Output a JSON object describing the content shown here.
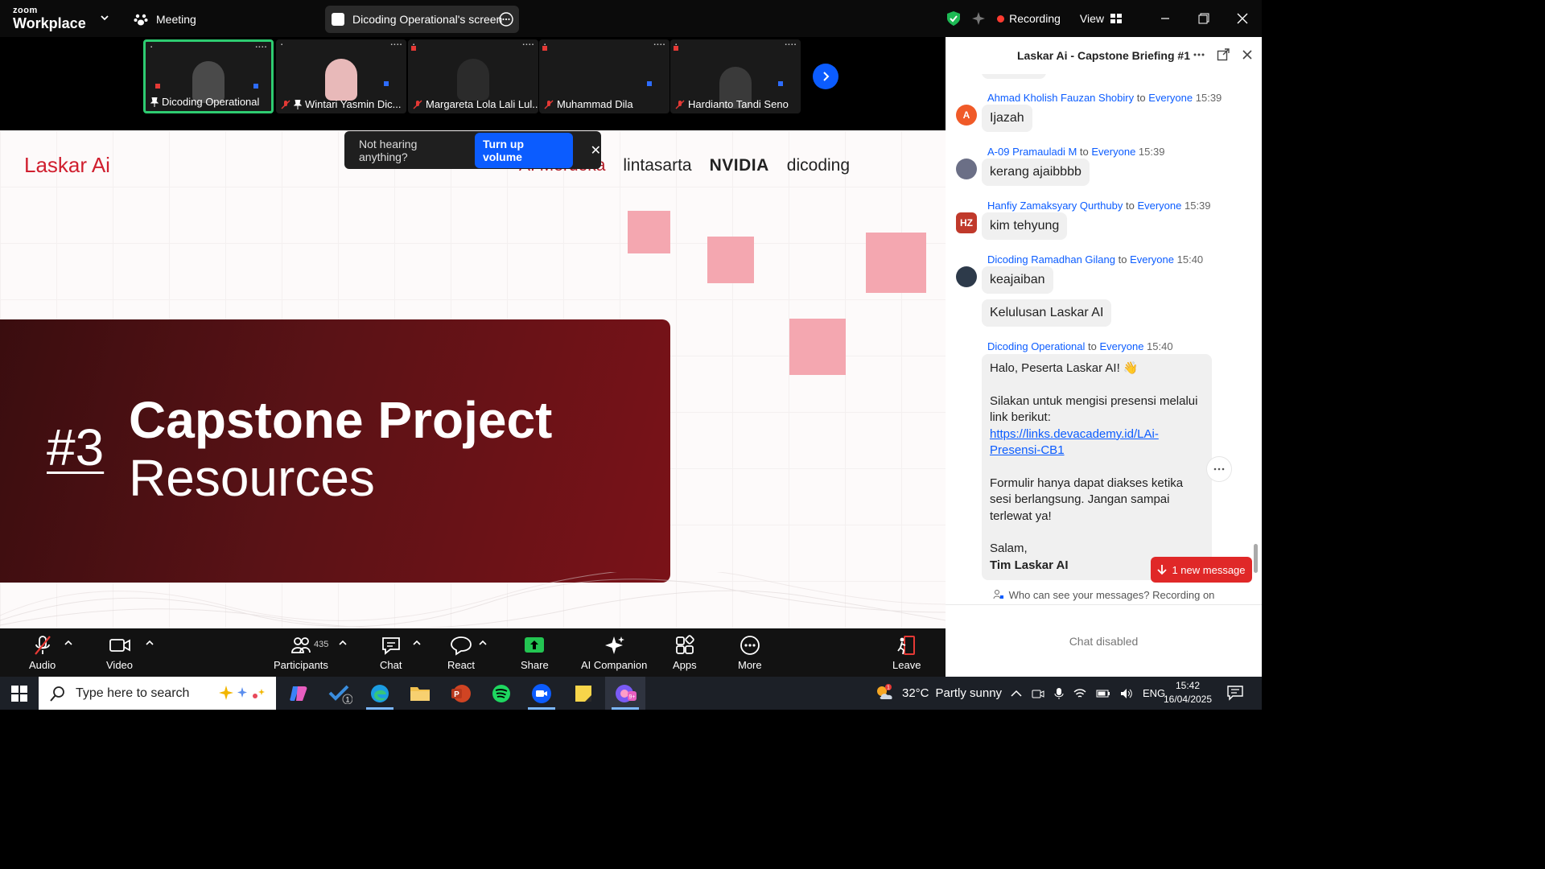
{
  "topbar": {
    "brand_small": "zoom",
    "brand_large": "Workplace",
    "meeting_label": "Meeting",
    "screen_label": "Dicoding Operational's screen",
    "recording_label": "Recording",
    "view_label": "View"
  },
  "strip": {
    "tiles": [
      {
        "name": "Dicoding Operational"
      },
      {
        "name": "Wintari Yasmin Dic..."
      },
      {
        "name": "Margareta Lola Lali Lul..."
      },
      {
        "name": "Muhammad Dila"
      },
      {
        "name": "Hardianto Tandi Seno"
      }
    ]
  },
  "slide": {
    "brand": "Laskar Ai",
    "partners": [
      "AI Merdeka",
      "lintasarta",
      "NVIDIA",
      "dicoding"
    ],
    "number": "#3",
    "title_bold": "Capstone Project",
    "title_light": "Resources"
  },
  "toast": {
    "text": "Not hearing anything?",
    "button": "Turn up volume"
  },
  "toolbar": {
    "audio": "Audio",
    "video": "Video",
    "participants": "Participants",
    "participants_count": "435",
    "chat": "Chat",
    "react": "React",
    "share": "Share",
    "ai_companion": "AI Companion",
    "apps": "Apps",
    "more": "More",
    "leave": "Leave"
  },
  "chat": {
    "title": "Laskar Ai - Capstone Briefing #1",
    "to_word": "to",
    "messages": [
      {
        "sender": "Ahmad Kholish Fauzan Shobiry",
        "recipient": "Everyone",
        "time": "15:39",
        "avatar": "A",
        "text": "Ijazah"
      },
      {
        "sender": "A-09 Pramauladi M",
        "recipient": "Everyone",
        "time": "15:39",
        "avatar": "",
        "text": "kerang ajaibbbb"
      },
      {
        "sender": "Hanfiy Zamaksyary Qurthuby",
        "recipient": "Everyone",
        "time": "15:39",
        "avatar": "HZ",
        "text": "kim tehyung"
      },
      {
        "sender": "Dicoding Ramadhan Gilang",
        "recipient": "Everyone",
        "time": "15:40",
        "avatar": "",
        "text": "keajaiban",
        "text2": "Kelulusan Laskar AI"
      },
      {
        "sender": "Dicoding Operational",
        "recipient": "Everyone",
        "time": "15:40"
      }
    ],
    "long_message": {
      "greeting": "Halo, Peserta Laskar AI! 👋",
      "line1": "Silakan untuk mengisi presensi melalui link berikut:",
      "link": "https://links.devacademy.id/LAi-Presensi-CB1",
      "line2": "Formulir hanya dapat diakses ketika sesi berlangsung. Jangan sampai terlewat ya!",
      "closing": "Salam,",
      "signature": "Tim Laskar AI"
    },
    "new_message": "1 new message",
    "who_can_see": "Who can see your messages? Recording on",
    "disabled": "Chat disabled"
  },
  "taskbar": {
    "search_placeholder": "Type here to search",
    "weather_temp": "32°C",
    "weather_desc": "Partly sunny",
    "weather_badge": "1",
    "lang": "ENG",
    "time": "15:42",
    "date": "16/04/2025",
    "todo_badge": "1"
  },
  "colors": {
    "accent": "#0b5cff",
    "brand_red": "#d01f2f",
    "recording": "#ff3b30",
    "active_tile": "#2ecc71",
    "new_message": "#e02828"
  }
}
